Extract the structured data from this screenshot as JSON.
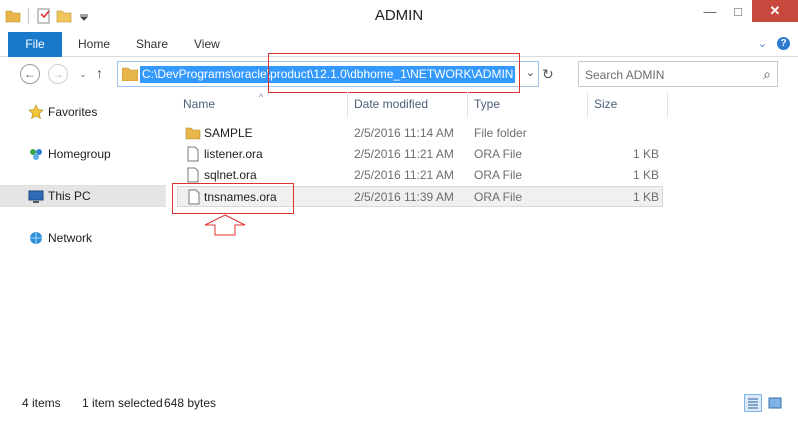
{
  "window": {
    "title": "ADMIN"
  },
  "window_buttons": {
    "minimize": "—",
    "maximize": "□",
    "close": "✕"
  },
  "ribbon": {
    "tabs": [
      "File",
      "Home",
      "Share",
      "View"
    ],
    "help_chevron": "⌄",
    "help": "?"
  },
  "nav": {
    "back": "←",
    "forward": "→",
    "up": "↑",
    "address_path": "C:\\DevPrograms\\oracle\\product\\12.1.0\\dbhome_1\\NETWORK\\ADMIN",
    "refresh": "↻",
    "dropdown": "⌄",
    "search_placeholder": "Search ADMIN",
    "search_glyph": "⌕"
  },
  "sidebar": {
    "items": [
      {
        "label": "Favorites",
        "icon": "star-icon"
      },
      {
        "label": "Homegroup",
        "icon": "homegroup-icon"
      },
      {
        "label": "This PC",
        "icon": "computer-icon",
        "selected": true
      },
      {
        "label": "Network",
        "icon": "network-icon"
      }
    ]
  },
  "columns": [
    "Name",
    "Date modified",
    "Type",
    "Size"
  ],
  "sort_caret": "^",
  "files": [
    {
      "name": "SAMPLE",
      "date": "2/5/2016 11:14 AM",
      "type": "File folder",
      "size": "",
      "icon": "folder-icon"
    },
    {
      "name": "listener.ora",
      "date": "2/5/2016 11:21 AM",
      "type": "ORA File",
      "size": "1 KB",
      "icon": "file-icon"
    },
    {
      "name": "sqlnet.ora",
      "date": "2/5/2016 11:21 AM",
      "type": "ORA File",
      "size": "1 KB",
      "icon": "file-icon"
    },
    {
      "name": "tnsnames.ora",
      "date": "2/5/2016 11:39 AM",
      "type": "ORA File",
      "size": "1 KB",
      "icon": "file-icon",
      "selected": true
    }
  ],
  "status": {
    "items_count": "4 items",
    "selected": "1 item selected",
    "selected_size": "648 bytes"
  },
  "colors": {
    "accent": "#1979ca",
    "selection": "#3399ff",
    "annotation": "#e03030",
    "folder": "#e8b64a"
  }
}
